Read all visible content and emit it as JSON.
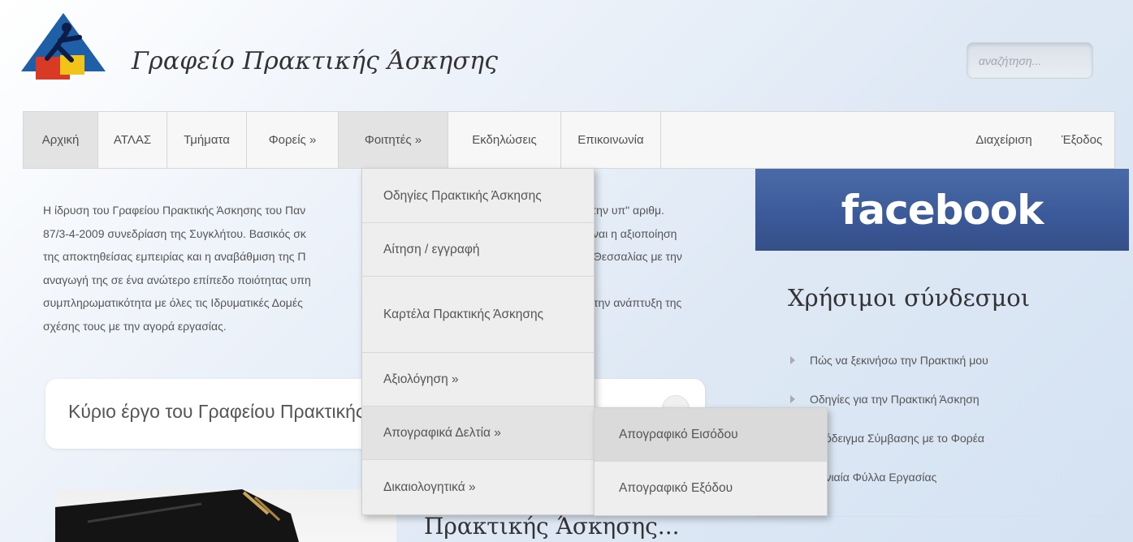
{
  "header": {
    "site_title": "Γραφείο Πρακτικής Άσκησης",
    "search_placeholder": "αναζήτηση..."
  },
  "nav": {
    "items": [
      {
        "label": "Αρχική",
        "active": true
      },
      {
        "label": "ΑΤΛΑΣ"
      },
      {
        "label": "Τμήματα"
      },
      {
        "label": "Φορείς »"
      },
      {
        "label": "Φοιτητές »",
        "active": true
      },
      {
        "label": "Εκδηλώσεις"
      },
      {
        "label": "Επικοινωνία"
      }
    ],
    "right": [
      {
        "label": "Διαχείριση"
      },
      {
        "label": "Έξοδος"
      }
    ]
  },
  "dropdown": {
    "items": [
      {
        "label": "Οδηγίες Πρακτικής Άσκησης"
      },
      {
        "label": "Αίτηση / εγγραφή"
      },
      {
        "label": "Καρτέλα Πρακτικής Άσκησης"
      },
      {
        "label": "Αξιολόγηση »"
      },
      {
        "label": "Απογραφικά Δελτία »"
      },
      {
        "label": "Δικαιολογητικά »"
      }
    ],
    "submenu": [
      {
        "label": "Απογραφικό Εισόδου"
      },
      {
        "label": "Απογραφικό Εξόδου"
      }
    ]
  },
  "main": {
    "intro_lines": [
      "Η ίδρυση του Γραφείου Πρακτικής Άσκησης του Παν",
      "87/3-4-2009 συνεδρίαση της Συγκλήτου. Βασικός σκ",
      "της αποκτηθείσας εμπειρίας και η αναβάθμιση της Π",
      "αναγωγή της σε ένα ανώτερο επίπεδο ποιότητας υπη",
      "συμπληρωματικότητα με όλες τις Ιδρυματικές Δομές",
      "σχέσης τους με την αγορά εργασίας."
    ],
    "intro_right_lines": [
      "στην υπ\" αριθμ.",
      "ναι η αξιοποίηση",
      "Θεσσαλίας με την",
      "",
      "την ανάπτυξη της",
      ""
    ],
    "box_title": "Κύριο έργο του Γραφείου Πρακτικής Άσκησης",
    "article_title": "Πρακτικής Άσκησης..."
  },
  "sidebar": {
    "facebook_label": "facebook",
    "title": "Χρήσιμοι σύνδεσμοι",
    "links": [
      "Πώς να ξεκινήσω την Πρακτική μου",
      "Οδηγίες για την Πρακτική Άσκηση",
      "Υπόδειγμα Σύμβασης με το Φορέα",
      "Μηνιαία Φύλλα Εργασίας"
    ]
  }
}
